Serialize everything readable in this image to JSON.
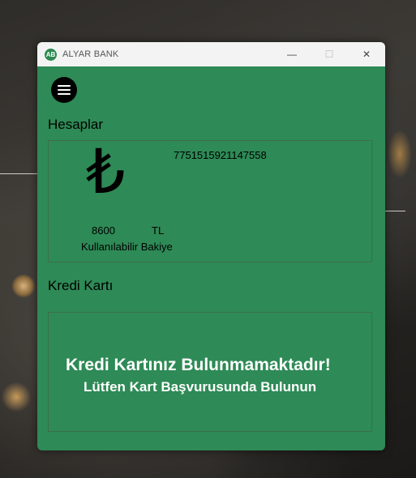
{
  "window": {
    "title": "ALYAR BANK",
    "icon_text": "AB",
    "controls": {
      "minimize": "—",
      "maximize": "☐",
      "close": "✕"
    }
  },
  "menu": {
    "icon": "hamburger-menu-icon"
  },
  "accounts": {
    "heading": "Hesaplar",
    "currency_symbol": "₺",
    "account_number": "7751515921147558",
    "balance": "8600",
    "currency": "TL",
    "balance_label": "Kullanılabilir Bakiye"
  },
  "credit_card": {
    "heading": "Kredi Kartı",
    "message_title": "Kredi Kartınız Bulunmamaktadır!",
    "message_subtitle": "Lütfen Kart Başvurusunda Bulunun"
  },
  "colors": {
    "window_bg": "#2e8a56",
    "titlebar_bg": "#f3f3f3"
  }
}
